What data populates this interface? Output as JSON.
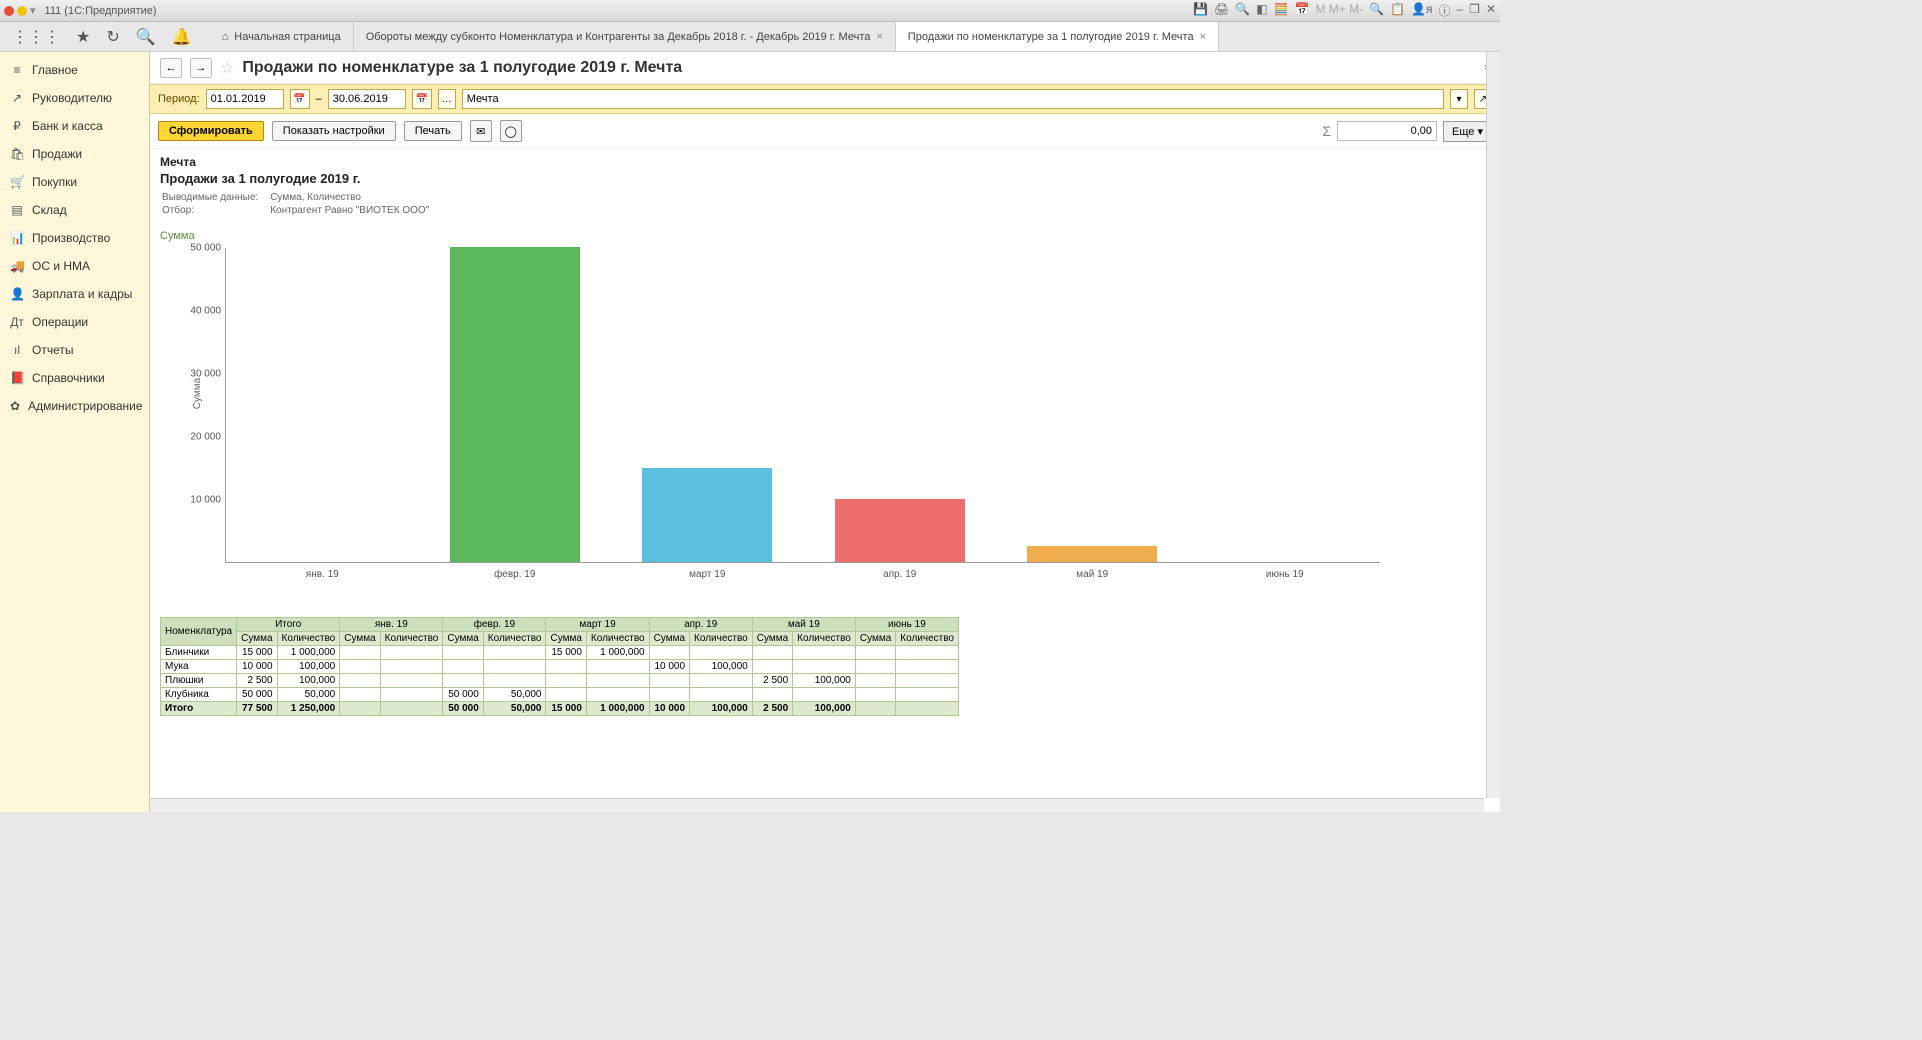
{
  "window_title": "111  (1С:Предприятие)",
  "tabs": {
    "home": "Начальная страница",
    "t1": "Обороты между субконто Номенклатура и Контрагенты за Декабрь 2018 г. - Декабрь 2019 г. Мечта",
    "t2": "Продажи по номенклатуре за 1 полугодие 2019 г. Мечта"
  },
  "sidebar": {
    "items": [
      {
        "icon": "≡",
        "label": "Главное"
      },
      {
        "icon": "↗",
        "label": "Руководителю"
      },
      {
        "icon": "₽",
        "label": "Банк и касса"
      },
      {
        "icon": "🛍",
        "label": "Продажи"
      },
      {
        "icon": "🛒",
        "label": "Покупки"
      },
      {
        "icon": "▤",
        "label": "Склад"
      },
      {
        "icon": "📊",
        "label": "Производство"
      },
      {
        "icon": "🚚",
        "label": "ОС и НМА"
      },
      {
        "icon": "👤",
        "label": "Зарплата и кадры"
      },
      {
        "icon": "Дт",
        "label": "Операции"
      },
      {
        "icon": "ıl",
        "label": "Отчеты"
      },
      {
        "icon": "📕",
        "label": "Справочники"
      },
      {
        "icon": "✿",
        "label": "Администрирование"
      }
    ]
  },
  "page_title": "Продажи по номенклатуре за 1 полугодие 2019 г. Мечта",
  "filter": {
    "period_label": "Период:",
    "from": "01.01.2019",
    "to": "30.06.2019",
    "dash": "–",
    "org": "Мечта"
  },
  "actions": {
    "form": "Сформировать",
    "settings": "Показать настройки",
    "print": "Печать",
    "sum": "0,00",
    "more": "Еще"
  },
  "report_header": {
    "org": "Мечта",
    "title": "Продажи за 1 полугодие 2019 г.",
    "outlabel": "Выводимые данные:",
    "out": "Сумма, Количество",
    "filtlabel": "Отбор:",
    "filt": "Контрагент Равно \"ВИОТЕК ООО\""
  },
  "chart_label": "Сумма",
  "chart_data": {
    "type": "bar",
    "ylabel": "Сумма",
    "ylim": [
      0,
      50000
    ],
    "yticks": [
      10000,
      20000,
      30000,
      40000,
      50000
    ],
    "ytick_labels": [
      "10 000",
      "20 000",
      "30 000",
      "40 000",
      "50 000"
    ],
    "categories": [
      "янв. 19",
      "февр. 19",
      "март 19",
      "апр. 19",
      "май 19",
      "июнь 19"
    ],
    "series": [
      {
        "name": "Клубника",
        "color": "#5cb85c",
        "values": [
          0,
          50000,
          0,
          0,
          0,
          0
        ]
      },
      {
        "name": "Плюшки",
        "color": "#f0ad4e",
        "values": [
          0,
          0,
          0,
          0,
          2500,
          0
        ]
      },
      {
        "name": "Мука",
        "color": "#ee6e6e",
        "values": [
          0,
          0,
          0,
          10000,
          0,
          0
        ]
      },
      {
        "name": "Блинчики",
        "color": "#5bc0de",
        "values": [
          0,
          0,
          15000,
          0,
          0,
          0
        ]
      }
    ]
  },
  "table": {
    "colhdr_top": [
      "Номенклатура",
      "Итого",
      "янв. 19",
      "февр. 19",
      "март 19",
      "апр. 19",
      "май 19",
      "июнь 19"
    ],
    "sub": {
      "sum": "Сумма",
      "qty": "Количество"
    },
    "rows": [
      {
        "name": "Блинчики",
        "total_s": "15 000",
        "total_q": "1 000,000",
        "m": {
          "mar": {
            "s": "15 000",
            "q": "1 000,000"
          }
        }
      },
      {
        "name": "Мука",
        "total_s": "10 000",
        "total_q": "100,000",
        "m": {
          "apr": {
            "s": "10 000",
            "q": "100,000"
          }
        }
      },
      {
        "name": "Плюшки",
        "total_s": "2 500",
        "total_q": "100,000",
        "m": {
          "may": {
            "s": "2 500",
            "q": "100,000"
          }
        }
      },
      {
        "name": "Клубника",
        "total_s": "50 000",
        "total_q": "50,000",
        "m": {
          "feb": {
            "s": "50 000",
            "q": "50,000"
          }
        }
      }
    ],
    "total": {
      "name": "Итого",
      "total_s": "77 500",
      "total_q": "1 250,000",
      "feb": {
        "s": "50 000",
        "q": "50,000"
      },
      "mar": {
        "s": "15 000",
        "q": "1 000,000"
      },
      "apr": {
        "s": "10 000",
        "q": "100,000"
      },
      "may": {
        "s": "2 500",
        "q": "100,000"
      }
    }
  }
}
